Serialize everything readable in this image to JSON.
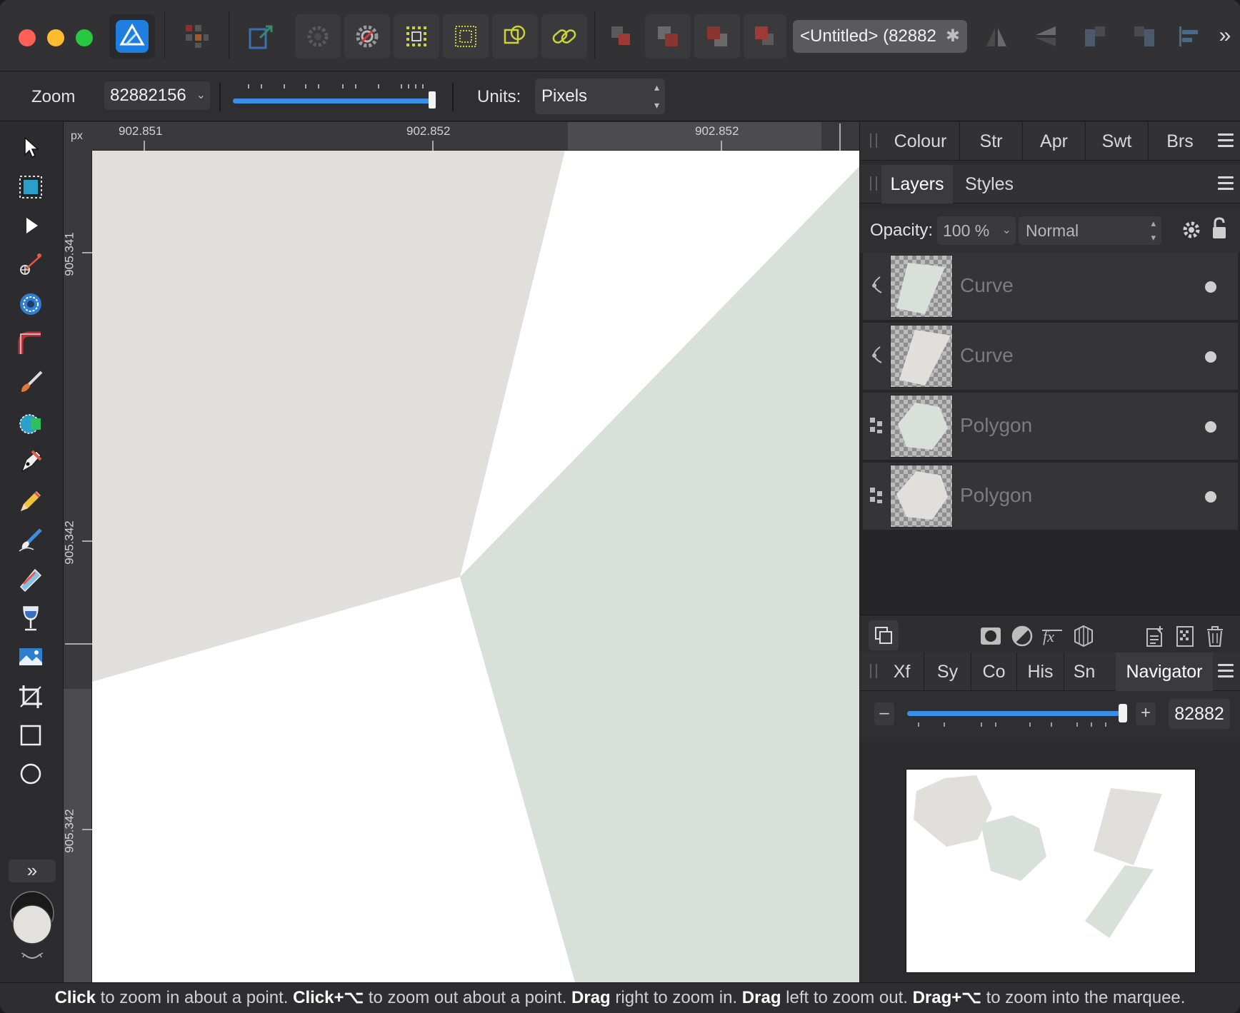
{
  "window": {
    "traffic_lights": [
      "close",
      "minimize",
      "maximize"
    ]
  },
  "toolbar": {
    "document_tab": "<Untitled> (82882",
    "document_tab_close": "✱",
    "more": "»",
    "buttons": [
      "affinity-designer-app-icon",
      "personas-icon",
      "export-persona-icon",
      "snapping-gear-icon",
      "snapping-settings-icon",
      "grid-icon",
      "pixel-grid-icon",
      "geometry-icon",
      "link-icon",
      "arrange-back-icon",
      "arrange-backward-icon",
      "arrange-forward-icon",
      "arrange-front-icon",
      "flip-horizontal-icon",
      "flip-vertical-icon",
      "rotate-left-icon",
      "rotate-right-icon",
      "align-icon"
    ]
  },
  "contextbar": {
    "zoom_label": "Zoom",
    "zoom_value": "82882156",
    "zoom_slider_fraction": 1.0,
    "units_label": "Units:",
    "units_value": "Pixels"
  },
  "rulers": {
    "unit": "px",
    "top_ticks": [
      "902.851",
      "902.852",
      "902.852"
    ],
    "left_ticks": [
      "905.341",
      "905.342",
      "905.342"
    ]
  },
  "tools": [
    "move-tool-icon",
    "artboard-tool-icon",
    "node-tool-icon",
    "point-transform-tool-icon",
    "contour-tool-icon",
    "corner-tool-icon",
    "paint-brush-tool-icon",
    "vector-flood-fill-tool-icon",
    "pen-tool-icon",
    "pencil-tool-icon",
    "vector-brush-tool-icon",
    "fill-tool-icon",
    "transparency-tool-icon",
    "place-image-tool-icon",
    "crop-tool-icon",
    "rectangle-tool-icon",
    "ellipse-tool-icon"
  ],
  "tools_more": "»",
  "colors": {
    "shape_beige": "#e1dfdb",
    "shape_green": "#d9e0d9",
    "fill_swatch": "#e3e1dd",
    "stroke_swatch": "#1a1a1a",
    "accent_blue": "#3b8ee8"
  },
  "panels": {
    "top_tabs": [
      "Colour",
      "Str",
      "Apr",
      "Swt",
      "Brs"
    ],
    "layers_tabs": [
      "Layers",
      "Styles"
    ],
    "opacity_label": "Opacity:",
    "opacity_value": "100 %",
    "blend_mode": "Normal",
    "layers": [
      {
        "name": "Curve",
        "type": "curve-icon",
        "thumb": "green-quad"
      },
      {
        "name": "Curve",
        "type": "curve-icon",
        "thumb": "beige-quad"
      },
      {
        "name": "Polygon",
        "type": "polygon-icon",
        "thumb": "green-hex"
      },
      {
        "name": "Polygon",
        "type": "polygon-icon",
        "thumb": "beige-hex"
      }
    ],
    "bottom_tabs": [
      "Xf",
      "Sy",
      "Co",
      "His",
      "Sn",
      "Navigator"
    ],
    "navigator_zoom": "82882",
    "navigator_slider_fraction": 1.0
  },
  "statusbar": [
    {
      "b": "Click",
      "t": " to zoom in about a point. "
    },
    {
      "b": "Click+⌥",
      "t": " to zoom out about a point. "
    },
    {
      "b": "Drag",
      "t": " right to zoom in. "
    },
    {
      "b": "Drag",
      "t": " left to zoom out. "
    },
    {
      "b": "Drag+⌥",
      "t": " to zoom into the marquee."
    }
  ]
}
